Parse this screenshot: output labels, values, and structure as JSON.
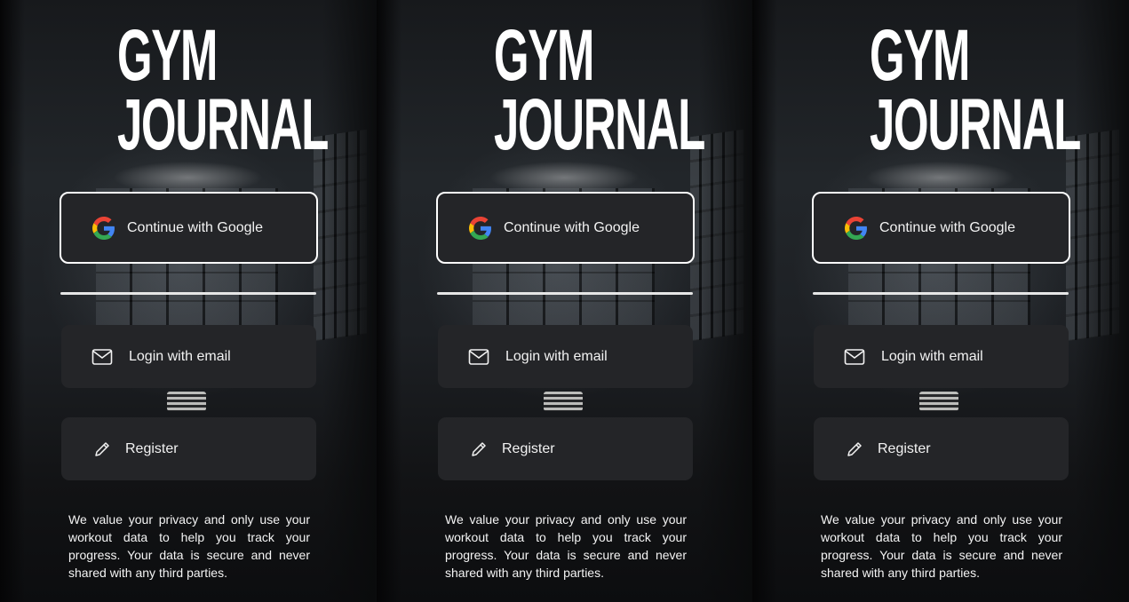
{
  "logo": {
    "line1": "GYM",
    "line2": "JOURNAL"
  },
  "auth": {
    "google_label": "Continue with Google",
    "email_label": "Login with email",
    "register_label": "Register"
  },
  "privacy_text": "We value your privacy and only use your workout data to help you track your progress. Your data is secure and never shared with any third parties.",
  "icons": {
    "google": "google-g-icon",
    "email": "envelope-icon",
    "register": "pencil-icon"
  },
  "colors": {
    "button_bg": "#242528",
    "button_border": "#ffffff",
    "text": "#f2f2f2",
    "google_blue": "#4285F4",
    "google_red": "#EA4335",
    "google_yellow": "#FBBC05",
    "google_green": "#34A853"
  }
}
